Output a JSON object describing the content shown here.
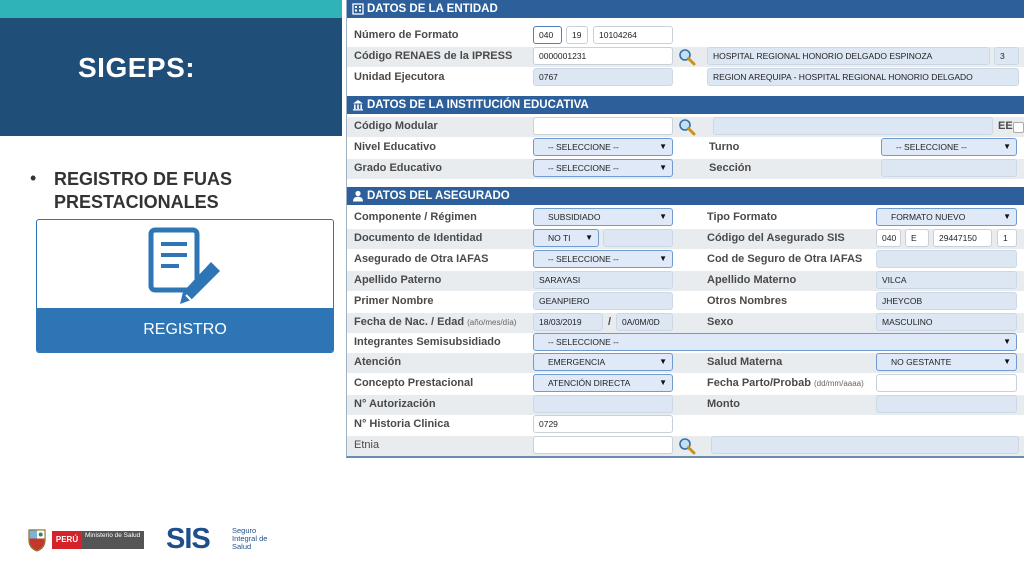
{
  "slide": {
    "title": "SIGEPS:",
    "bullet": "REGISTRO DE FUAS PRESTACIONALES",
    "card_label": "REGISTRO"
  },
  "sections": {
    "entidad": "DATOS DE LA ENTIDAD",
    "institucion": "DATOS DE LA INSTITUCIÓN EDUCATIVA",
    "asegurado": "DATOS DEL ASEGURADO"
  },
  "entidad": {
    "numero_formato_label": "Número de Formato",
    "numero_formato_a": "040",
    "numero_formato_b": "19",
    "numero_formato_c": "10104264",
    "renaes_label": "Código RENAES de la IPRESS",
    "renaes_value": "0000001231",
    "renaes_name": "HOSPITAL REGIONAL HONORIO DELGADO ESPINOZA",
    "renaes_cat": "3",
    "unidad_label": "Unidad Ejecutora",
    "unidad_value": "0767",
    "unidad_name": "REGION AREQUIPA - HOSPITAL REGIONAL HONORIO DELGADO"
  },
  "institucion": {
    "codigo_modular_label": "Código Modular",
    "codigo_modular_value": "",
    "codigo_modular_name": "",
    "ee_label": "EE",
    "nivel_label": "Nivel Educativo",
    "nivel_value": "-- SELECCIONE --",
    "turno_label": "Turno",
    "turno_value": "-- SELECCIONE --",
    "grado_label": "Grado Educativo",
    "grado_value": "-- SELECCIONE --",
    "seccion_label": "Sección",
    "seccion_value": ""
  },
  "asegurado": {
    "componente_label": "Componente / Régimen",
    "componente_value": "SUBSIDIADO",
    "tipo_formato_label": "Tipo Formato",
    "tipo_formato_value": "FORMATO NUEVO",
    "documento_label": "Documento de Identidad",
    "documento_tipo": "NO TI",
    "documento_numero": "",
    "codigo_sis_label": "Código del Asegurado SIS",
    "codigo_sis_a": "040",
    "codigo_sis_b": "E",
    "codigo_sis_c": "29447150",
    "codigo_sis_d": "1",
    "otra_iafas_label": "Asegurado de Otra IAFAS",
    "otra_iafas_value": "-- SELECCIONE --",
    "cod_otra_iafas_label": "Cod de Seguro de Otra IAFAS",
    "cod_otra_iafas_value": "",
    "apellido_paterno_label": "Apellido Paterno",
    "apellido_paterno_value": "SARAYASI",
    "apellido_materno_label": "Apellido Materno",
    "apellido_materno_value": "VILCA",
    "primer_nombre_label": "Primer Nombre",
    "primer_nombre_value": "GEANPIERO",
    "otros_nombres_label": "Otros Nombres",
    "otros_nombres_value": "JHEYCOB",
    "fecha_nac_label": "Fecha de Nac. / Edad",
    "fecha_nac_hint": "(año/mes/día)",
    "fecha_nac_value": "18/03/2019",
    "slash": "/",
    "edad_value": "0A/0M/0D",
    "sexo_label": "Sexo",
    "sexo_value": "MASCULINO",
    "integrantes_label": "Integrantes Semisubsidiado",
    "integrantes_value": "-- SELECCIONE --",
    "atencion_label": "Atención",
    "atencion_value": "EMERGENCIA",
    "salud_materna_label": "Salud Materna",
    "salud_materna_value": "NO GESTANTE",
    "concepto_label": "Concepto Prestacional",
    "concepto_value": "ATENCIÓN DIRECTA",
    "fecha_parto_label": "Fecha Parto/Probab",
    "fecha_parto_hint": "(dd/mm/aaaa)",
    "fecha_parto_value": "",
    "autorizacion_label": "N° Autorización",
    "autorizacion_value": "",
    "monto_label": "Monto",
    "monto_value": "",
    "historia_label": "N° Historia Clinica",
    "historia_value": "0729",
    "etnia_label": "Etnia",
    "etnia_value": "",
    "etnia_name": ""
  },
  "logos": {
    "peru": "PERÚ",
    "ministerio": "Ministerio de Salud",
    "sis": "SIS",
    "sis_sub": "Seguro Integral de Salud"
  },
  "icons": [
    "pen-document-icon",
    "building-icon",
    "institution-icon",
    "person-icon",
    "magnifier-icon",
    "dropdown-caret-icon"
  ]
}
